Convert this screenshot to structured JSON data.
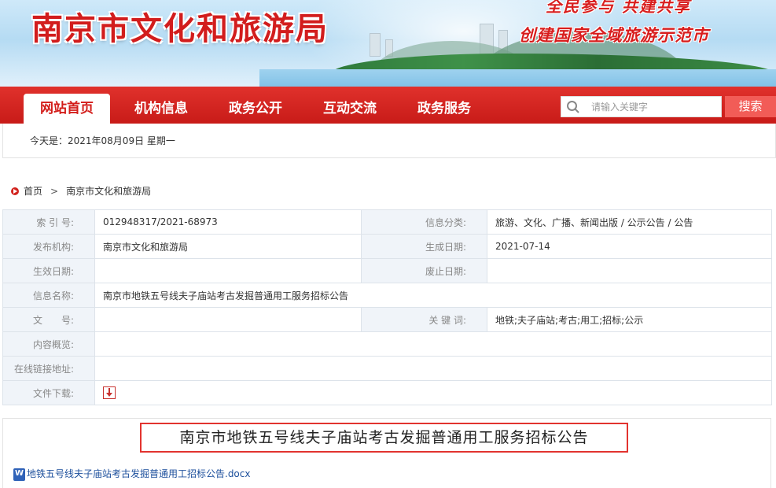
{
  "banner": {
    "site_title": "南京市文化和旅游局",
    "slogan_line1": "全民参与 共建共享",
    "slogan_line2": "创建国家全域旅游示范市"
  },
  "nav": {
    "tabs": [
      {
        "label": "网站首页",
        "active": true
      },
      {
        "label": "机构信息",
        "active": false
      },
      {
        "label": "政务公开",
        "active": false
      },
      {
        "label": "互动交流",
        "active": false
      },
      {
        "label": "政务服务",
        "active": false
      }
    ],
    "search_placeholder": "请输入关键字",
    "search_button": "搜索"
  },
  "date_bar": {
    "text": "今天是：2021年08月09日 星期一"
  },
  "breadcrumb": {
    "home": "首页",
    "separator": ">",
    "current": "南京市文化和旅游局"
  },
  "info_table": {
    "index_label": "索 引 号:",
    "index_value": "012948317/2021-68973",
    "category_label": "信息分类:",
    "category_value": "旅游、文化、广播、新闻出版 / 公示公告 / 公告",
    "publisher_label": "发布机构:",
    "publisher_value": "南京市文化和旅游局",
    "created_label": "生成日期:",
    "created_value": "2021-07-14",
    "effective_label": "生效日期:",
    "effective_value": "",
    "repeal_label": "废止日期:",
    "repeal_value": "",
    "name_label": "信息名称:",
    "name_value": "南京市地铁五号线夫子庙站考古发掘普通用工服务招标公告",
    "docno_label": "文　　号:",
    "docno_value": "",
    "keywords_label": "关 键 词:",
    "keywords_value": "地铁;夫子庙站;考古;用工;招标;公示",
    "overview_label": "内容概览:",
    "overview_value": "",
    "link_label": "在线链接地址:",
    "link_value": "",
    "download_label": "文件下载:"
  },
  "article": {
    "title": "南京市地铁五号线夫子庙站考古发掘普通用工服务招标公告",
    "attachment": "地铁五号线夫子庙站考古发掘普通用工招标公告.docx"
  },
  "colors": {
    "brand_red": "#d31d1a",
    "nav_red": "#c81b18",
    "search_btn": "#f25c57",
    "label_bg": "#f0f4f9",
    "link_blue": "#1c4f9c"
  }
}
